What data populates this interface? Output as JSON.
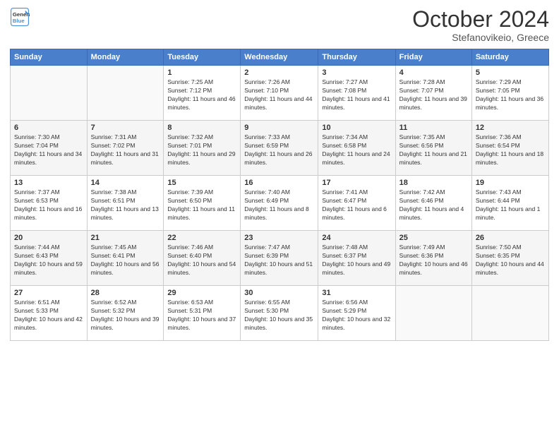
{
  "header": {
    "logo_line1": "General",
    "logo_line2": "Blue",
    "month": "October 2024",
    "location": "Stefanovikeio, Greece"
  },
  "weekdays": [
    "Sunday",
    "Monday",
    "Tuesday",
    "Wednesday",
    "Thursday",
    "Friday",
    "Saturday"
  ],
  "weeks": [
    [
      {
        "day": "",
        "info": ""
      },
      {
        "day": "",
        "info": ""
      },
      {
        "day": "1",
        "info": "Sunrise: 7:25 AM\nSunset: 7:12 PM\nDaylight: 11 hours and 46 minutes."
      },
      {
        "day": "2",
        "info": "Sunrise: 7:26 AM\nSunset: 7:10 PM\nDaylight: 11 hours and 44 minutes."
      },
      {
        "day": "3",
        "info": "Sunrise: 7:27 AM\nSunset: 7:08 PM\nDaylight: 11 hours and 41 minutes."
      },
      {
        "day": "4",
        "info": "Sunrise: 7:28 AM\nSunset: 7:07 PM\nDaylight: 11 hours and 39 minutes."
      },
      {
        "day": "5",
        "info": "Sunrise: 7:29 AM\nSunset: 7:05 PM\nDaylight: 11 hours and 36 minutes."
      }
    ],
    [
      {
        "day": "6",
        "info": "Sunrise: 7:30 AM\nSunset: 7:04 PM\nDaylight: 11 hours and 34 minutes."
      },
      {
        "day": "7",
        "info": "Sunrise: 7:31 AM\nSunset: 7:02 PM\nDaylight: 11 hours and 31 minutes."
      },
      {
        "day": "8",
        "info": "Sunrise: 7:32 AM\nSunset: 7:01 PM\nDaylight: 11 hours and 29 minutes."
      },
      {
        "day": "9",
        "info": "Sunrise: 7:33 AM\nSunset: 6:59 PM\nDaylight: 11 hours and 26 minutes."
      },
      {
        "day": "10",
        "info": "Sunrise: 7:34 AM\nSunset: 6:58 PM\nDaylight: 11 hours and 24 minutes."
      },
      {
        "day": "11",
        "info": "Sunrise: 7:35 AM\nSunset: 6:56 PM\nDaylight: 11 hours and 21 minutes."
      },
      {
        "day": "12",
        "info": "Sunrise: 7:36 AM\nSunset: 6:54 PM\nDaylight: 11 hours and 18 minutes."
      }
    ],
    [
      {
        "day": "13",
        "info": "Sunrise: 7:37 AM\nSunset: 6:53 PM\nDaylight: 11 hours and 16 minutes."
      },
      {
        "day": "14",
        "info": "Sunrise: 7:38 AM\nSunset: 6:51 PM\nDaylight: 11 hours and 13 minutes."
      },
      {
        "day": "15",
        "info": "Sunrise: 7:39 AM\nSunset: 6:50 PM\nDaylight: 11 hours and 11 minutes."
      },
      {
        "day": "16",
        "info": "Sunrise: 7:40 AM\nSunset: 6:49 PM\nDaylight: 11 hours and 8 minutes."
      },
      {
        "day": "17",
        "info": "Sunrise: 7:41 AM\nSunset: 6:47 PM\nDaylight: 11 hours and 6 minutes."
      },
      {
        "day": "18",
        "info": "Sunrise: 7:42 AM\nSunset: 6:46 PM\nDaylight: 11 hours and 4 minutes."
      },
      {
        "day": "19",
        "info": "Sunrise: 7:43 AM\nSunset: 6:44 PM\nDaylight: 11 hours and 1 minute."
      }
    ],
    [
      {
        "day": "20",
        "info": "Sunrise: 7:44 AM\nSunset: 6:43 PM\nDaylight: 10 hours and 59 minutes."
      },
      {
        "day": "21",
        "info": "Sunrise: 7:45 AM\nSunset: 6:41 PM\nDaylight: 10 hours and 56 minutes."
      },
      {
        "day": "22",
        "info": "Sunrise: 7:46 AM\nSunset: 6:40 PM\nDaylight: 10 hours and 54 minutes."
      },
      {
        "day": "23",
        "info": "Sunrise: 7:47 AM\nSunset: 6:39 PM\nDaylight: 10 hours and 51 minutes."
      },
      {
        "day": "24",
        "info": "Sunrise: 7:48 AM\nSunset: 6:37 PM\nDaylight: 10 hours and 49 minutes."
      },
      {
        "day": "25",
        "info": "Sunrise: 7:49 AM\nSunset: 6:36 PM\nDaylight: 10 hours and 46 minutes."
      },
      {
        "day": "26",
        "info": "Sunrise: 7:50 AM\nSunset: 6:35 PM\nDaylight: 10 hours and 44 minutes."
      }
    ],
    [
      {
        "day": "27",
        "info": "Sunrise: 6:51 AM\nSunset: 5:33 PM\nDaylight: 10 hours and 42 minutes."
      },
      {
        "day": "28",
        "info": "Sunrise: 6:52 AM\nSunset: 5:32 PM\nDaylight: 10 hours and 39 minutes."
      },
      {
        "day": "29",
        "info": "Sunrise: 6:53 AM\nSunset: 5:31 PM\nDaylight: 10 hours and 37 minutes."
      },
      {
        "day": "30",
        "info": "Sunrise: 6:55 AM\nSunset: 5:30 PM\nDaylight: 10 hours and 35 minutes."
      },
      {
        "day": "31",
        "info": "Sunrise: 6:56 AM\nSunset: 5:29 PM\nDaylight: 10 hours and 32 minutes."
      },
      {
        "day": "",
        "info": ""
      },
      {
        "day": "",
        "info": ""
      }
    ]
  ]
}
